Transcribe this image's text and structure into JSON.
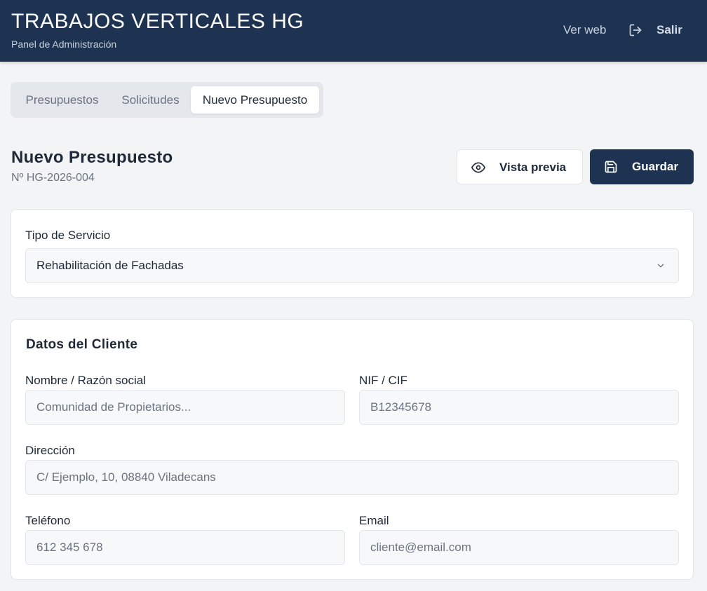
{
  "header": {
    "title": "TRABAJOS VERTICALES HG",
    "subtitle": "Panel de Administración",
    "ver_web": "Ver web",
    "salir": "Salir"
  },
  "tabs": [
    {
      "label": "Presupuestos",
      "active": false
    },
    {
      "label": "Solicitudes",
      "active": false
    },
    {
      "label": "Nuevo Presupuesto",
      "active": true
    }
  ],
  "page": {
    "title": "Nuevo Presupuesto",
    "number": "Nº HG-2026-004"
  },
  "actions": {
    "preview_label": "Vista previa",
    "save_label": "Guardar"
  },
  "service": {
    "label": "Tipo de Servicio",
    "selected": "Rehabilitación de Fachadas"
  },
  "client": {
    "section_title": "Datos del Cliente",
    "name": {
      "label": "Nombre / Razón social",
      "placeholder": "Comunidad de Propietarios...",
      "value": ""
    },
    "nif": {
      "label": "NIF / CIF",
      "placeholder": "B12345678",
      "value": ""
    },
    "address": {
      "label": "Dirección",
      "placeholder": "C/ Ejemplo, 10, 08840 Viladecans",
      "value": ""
    },
    "phone": {
      "label": "Teléfono",
      "placeholder": "612 345 678",
      "value": ""
    },
    "email": {
      "label": "Email",
      "placeholder": "cliente@email.com",
      "value": ""
    }
  },
  "icons": {
    "logout": "logout-icon",
    "eye": "eye-icon",
    "save": "floppy-disk-icon",
    "chevron": "chevron-down-icon"
  },
  "colors": {
    "brand": "#1e3352",
    "background": "#f3f4f6",
    "card": "#ffffff",
    "border": "#e2e5ea",
    "input_bg": "#f7f8fa"
  }
}
